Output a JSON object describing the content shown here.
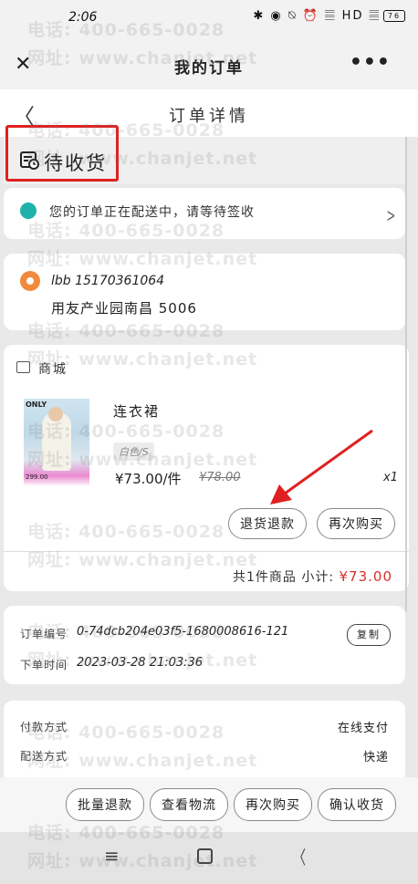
{
  "status_bar": {
    "time": "2:06",
    "icons": "✱ ◉ ⍉ ⏰ 𝄚 HD 𝄚",
    "battery": "76"
  },
  "top_header": {
    "title": "我的订单",
    "close": "✕",
    "more": "•••"
  },
  "detail_header": {
    "back": "〈",
    "title": "订单详情"
  },
  "order_status": {
    "label": "待收货"
  },
  "delivery": {
    "message": "您的订单正在配送中，请等待签收"
  },
  "address": {
    "name_phone": "lbb 15170361064",
    "detail": "用友产业园南昌 5006"
  },
  "shop": {
    "name": "商城"
  },
  "product": {
    "image_brand": "ONLY",
    "image_price": "299.00",
    "name": "连衣裙",
    "spec": "白色/S",
    "price": "¥73.00/件",
    "original_price": "¥78.00",
    "quantity": "x1",
    "refund_btn": "退货退款",
    "rebuy_btn": "再次购买"
  },
  "summary": {
    "count_text": "共1件商品",
    "subtotal_label": "小计:",
    "subtotal_amount": "¥73.00"
  },
  "order_info": {
    "no_label": "订单编号",
    "no_value": "0-74dcb204e03f5-1680008616-121",
    "copy_btn": "复制",
    "time_label": "下单时间",
    "time_value": "2023-03-28 21:03:36"
  },
  "payment": {
    "pay_label": "付款方式",
    "pay_value": "在线支付",
    "ship_label": "配送方式",
    "ship_value": "快递"
  },
  "bottom_actions": {
    "batch_refund": "批量退款",
    "view_logistics": "查看物流",
    "rebuy": "再次购买",
    "confirm_receipt": "确认收货"
  },
  "nav": {
    "menu": "≡",
    "back": "〈"
  },
  "watermark": {
    "phone": "电话: 400-665-0028",
    "site": "网址: www.chanjet.net"
  },
  "colors": {
    "highlight_red": "#e02020",
    "price_red": "#d9302b",
    "truck_teal": "#20b2aa",
    "location_orange": "#f08a3c"
  }
}
